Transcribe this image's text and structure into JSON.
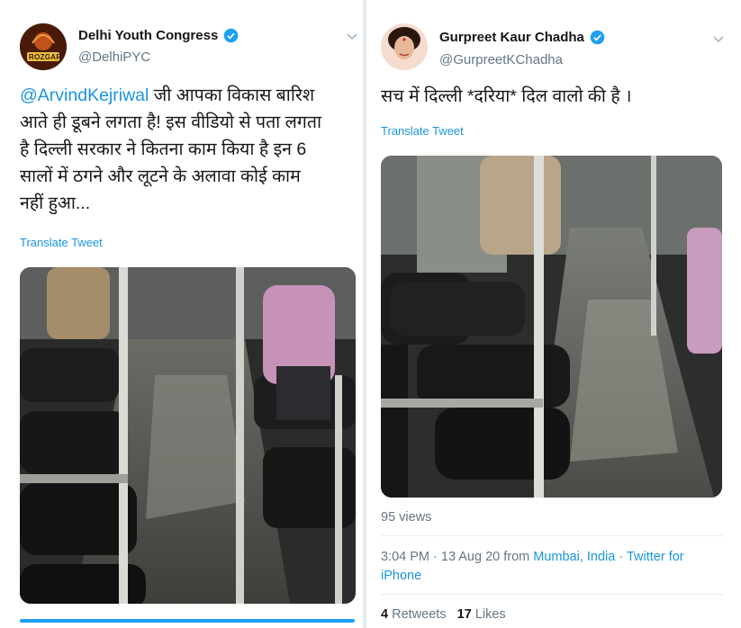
{
  "left_tweet": {
    "display_name": "Delhi Youth Congress",
    "handle": "@DelhiPYC",
    "avatar_text": "ROZGAR",
    "mention": "@ArvindKejriwal",
    "text_line1": " जी आपका विकास बारिश",
    "text_line2": "आते ही डूबने लगता है! इस वीडियो से पता लगता",
    "text_line3": "है दिल्ली सरकार ने कितना काम किया है इन 6",
    "text_line4": "सालों में ठगने और लूटने के अलावा कोई काम",
    "text_line5": "नहीं हुआ...",
    "translate_label": "Translate Tweet"
  },
  "right_tweet": {
    "display_name": "Gurpreet Kaur Chadha",
    "handle": "@GurpreetKChadha",
    "text": "सच में दिल्ली *दरिया* दिल वालो की है ।",
    "translate_label": "Translate Tweet",
    "views": "95 views",
    "time": "3:04 PM · 13 Aug 20 from ",
    "location": "Mumbai, India",
    "separator": " · ",
    "client_line1": "Twitter for",
    "client_line2": "iPhone",
    "retweets_count": "4",
    "retweets_label": " Retweets",
    "likes_count": "17",
    "likes_label": " Likes"
  },
  "colors": {
    "link": "#1b95e0",
    "verified": "#1da1f2",
    "muted": "#657786",
    "text": "#14171a"
  },
  "icons": [
    "verified-badge-icon",
    "chevron-down-icon"
  ]
}
